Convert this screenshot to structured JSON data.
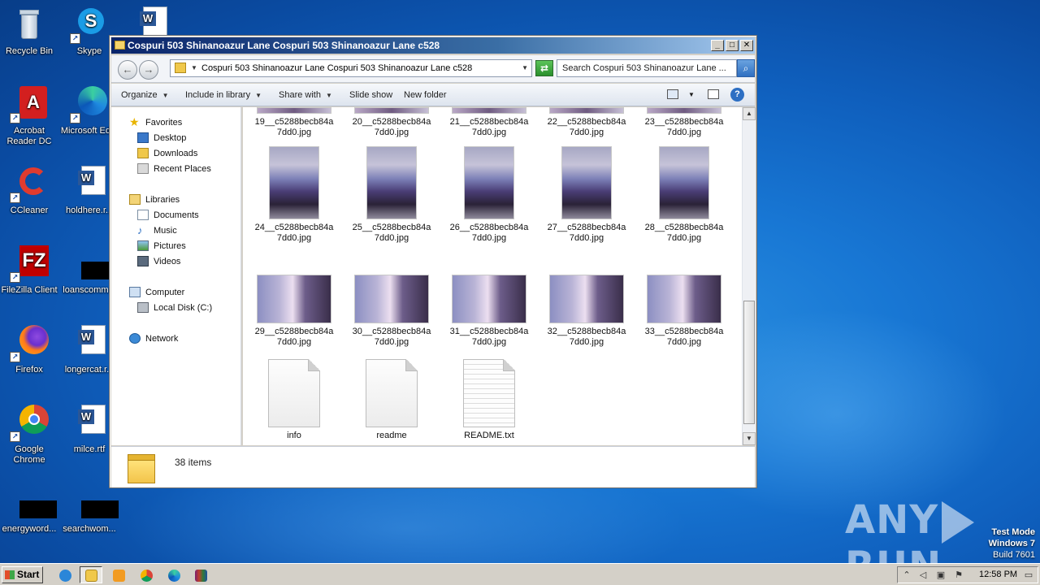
{
  "desktop": {
    "icons": [
      {
        "label": "Recycle Bin"
      },
      {
        "label": "Skype"
      },
      {
        "label": ""
      },
      {
        "label": "Acrobat Reader DC"
      },
      {
        "label": "Microsoft Ed..."
      },
      {
        "label": "CCleaner"
      },
      {
        "label": "holdhere.r..."
      },
      {
        "label": "FileZilla Client"
      },
      {
        "label": "loanscomm..."
      },
      {
        "label": "Firefox"
      },
      {
        "label": "longercat.r..."
      },
      {
        "label": "Google Chrome"
      },
      {
        "label": "milce.rtf"
      },
      {
        "label": "energyword..."
      },
      {
        "label": "searchwom..."
      }
    ]
  },
  "window": {
    "title": "Cospuri 503 Shinanoazur Lane Cospuri 503 Shinanoazur Lane c528",
    "address": "Cospuri 503 Shinanoazur Lane Cospuri 503 Shinanoazur Lane c528",
    "search_placeholder": "Search Cospuri 503 Shinanoazur Lane ...",
    "toolbar": {
      "organize": "Organize",
      "include_in_library": "Include in library",
      "share_with": "Share with",
      "slide_show": "Slide show",
      "new_folder": "New folder"
    },
    "nav": {
      "favorites": "Favorites",
      "desktop": "Desktop",
      "downloads": "Downloads",
      "recent_places": "Recent Places",
      "libraries": "Libraries",
      "documents": "Documents",
      "music": "Music",
      "pictures": "Pictures",
      "videos": "Videos",
      "computer": "Computer",
      "local_disk": "Local Disk (C:)",
      "network": "Network"
    },
    "files": [
      {
        "line1": "19__c5288becb84a",
        "line2": "7dd0.jpg"
      },
      {
        "line1": "20__c5288becb84a",
        "line2": "7dd0.jpg"
      },
      {
        "line1": "21__c5288becb84a",
        "line2": "7dd0.jpg"
      },
      {
        "line1": "22__c5288becb84a",
        "line2": "7dd0.jpg"
      },
      {
        "line1": "23__c5288becb84a",
        "line2": "7dd0.jpg"
      },
      {
        "line1": "24__c5288becb84a",
        "line2": "7dd0.jpg"
      },
      {
        "line1": "25__c5288becb84a",
        "line2": "7dd0.jpg"
      },
      {
        "line1": "26__c5288becb84a",
        "line2": "7dd0.jpg"
      },
      {
        "line1": "27__c5288becb84a",
        "line2": "7dd0.jpg"
      },
      {
        "line1": "28__c5288becb84a",
        "line2": "7dd0.jpg"
      },
      {
        "line1": "29__c5288becb84a",
        "line2": "7dd0.jpg"
      },
      {
        "line1": "30__c5288becb84a",
        "line2": "7dd0.jpg"
      },
      {
        "line1": "31__c5288becb84a",
        "line2": "7dd0.jpg"
      },
      {
        "line1": "32__c5288becb84a",
        "line2": "7dd0.jpg"
      },
      {
        "line1": "33__c5288becb84a",
        "line2": "7dd0.jpg"
      },
      {
        "line1": "info",
        "line2": ""
      },
      {
        "line1": "readme",
        "line2": ""
      },
      {
        "line1": "README.txt",
        "line2": ""
      }
    ],
    "status": {
      "item_count": "38 items"
    }
  },
  "watermark": {
    "brand_left": "ANY",
    "brand_right": "RUN",
    "test_mode": "Test Mode",
    "os": "Windows 7",
    "build": "Build 7601"
  },
  "taskbar": {
    "start_label": "Start",
    "clock": "12:58 PM"
  },
  "colors": {
    "desktop_blue": "#1877d4",
    "titlebar_start": "#0a246a",
    "taskbar_gray": "#d4d0c8"
  }
}
